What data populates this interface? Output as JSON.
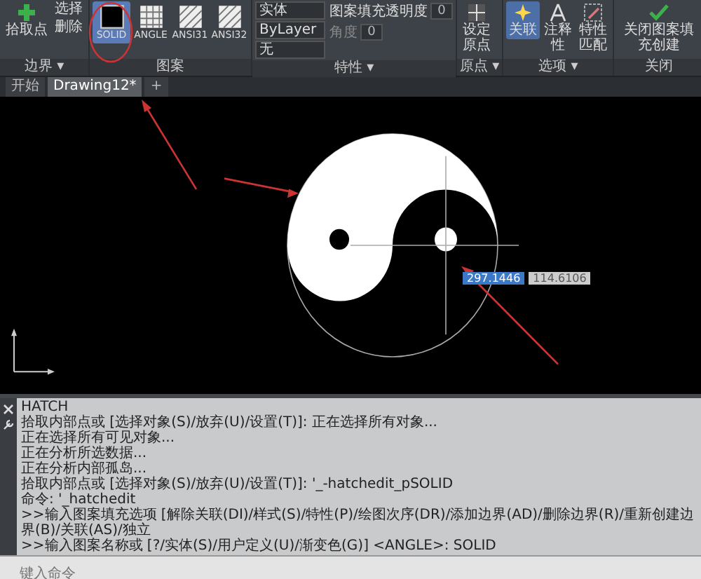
{
  "ribbon": {
    "boundary": {
      "pick_button": "拾取点",
      "small_buttons": [
        "选择",
        "删除"
      ],
      "panel_label": "边界 ▾"
    },
    "pattern": {
      "swatches": [
        {
          "label": "SOLID",
          "kind": "solid",
          "selected": true
        },
        {
          "label": "ANGLE",
          "kind": "grid",
          "selected": false
        },
        {
          "label": "ANSI31",
          "kind": "hatch",
          "selected": false
        },
        {
          "label": "ANSI32",
          "kind": "hatch",
          "selected": false
        }
      ],
      "panel_label": "图案"
    },
    "properties": {
      "type": "实体",
      "layer": "ByLayer",
      "background": "无",
      "transparency_label": "图案填充透明度",
      "transparency_value": "0",
      "angle_label": "角度",
      "angle_value": "0",
      "panel_label": "特性 ▾"
    },
    "origin": {
      "button": "设定原点",
      "panel_label": "原点 ▾"
    },
    "options": {
      "buttons": [
        {
          "label": "关联",
          "kind": "link",
          "selected": true
        },
        {
          "label": "注释性",
          "kind": "annot",
          "selected": false
        },
        {
          "label": "特性匹配",
          "kind": "match",
          "selected": false
        }
      ],
      "panel_label": "选项 ▾"
    },
    "close": {
      "button": "关闭图案填充创建",
      "panel_label": "关闭"
    }
  },
  "tabs": [
    {
      "label": "开始",
      "selected": false
    },
    {
      "label": "Drawing12*",
      "selected": true
    },
    {
      "label": "+",
      "selected": false
    }
  ],
  "canvas": {
    "input_values": [
      "297.1446",
      "114.6106"
    ]
  },
  "command_history": [
    "HATCH",
    "拾取内部点或 [选择对象(S)/放弃(U)/设置(T)]: 正在选择所有对象...",
    "正在选择所有可见对象...",
    "正在分析所选数据...",
    "正在分析内部孤岛...",
    "拾取内部点或 [选择对象(S)/放弃(U)/设置(T)]: '_-hatchedit_pSOLID",
    "命令: '_hatchedit",
    ">>输入图案填充选项 [解除关联(DI)/样式(S)/特性(P)/绘图次序(DR)/添加边界(AD)/删除边界(R)/重新创建边界(B)/关联(AS)/独立",
    ">>输入图案名称或 [?/实体(S)/用户定义(U)/渐变色(G)] <ANGLE>: SOLID"
  ],
  "command_line": {
    "placeholder": "键入命令"
  }
}
